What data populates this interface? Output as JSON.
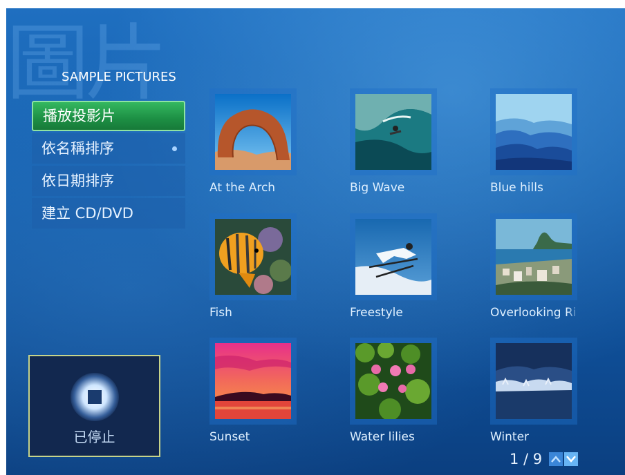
{
  "header": {
    "watermark": "圖片",
    "section_title": "SAMPLE PICTURES"
  },
  "menu": {
    "items": [
      {
        "label": "播放投影片",
        "selected": true
      },
      {
        "label": "依名稱排序"
      },
      {
        "label": "依日期排序"
      },
      {
        "label": "建立 CD/DVD"
      }
    ]
  },
  "player": {
    "status": "已停止"
  },
  "pictures": [
    {
      "caption": "At the Arch"
    },
    {
      "caption": "Big Wave"
    },
    {
      "caption": "Blue hills"
    },
    {
      "caption": "Fish"
    },
    {
      "caption": "Freestyle"
    },
    {
      "caption": "Overlooking Ri"
    },
    {
      "caption": "Sunset"
    },
    {
      "caption": "Water lilies"
    },
    {
      "caption": "Winter"
    }
  ],
  "pager": {
    "text": "1 / 9"
  },
  "colors": {
    "background": "#155fad",
    "selected": "#1d8f44",
    "status_frame": "#c7d48a"
  }
}
